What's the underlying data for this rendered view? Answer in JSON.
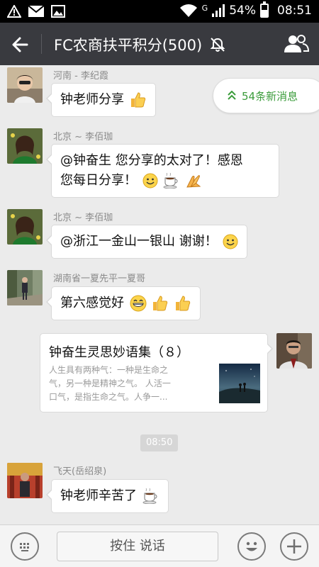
{
  "status_bar": {
    "battery": "54%",
    "battery_level": 0.54,
    "network": "G",
    "time": "08:51",
    "left_icons": [
      "warning-icon",
      "mail-icon",
      "image-icon"
    ]
  },
  "header": {
    "title": "FC农商扶平积分(500)",
    "muted": true
  },
  "new_messages": {
    "label": "54条新消息"
  },
  "messages": [
    {
      "sender": "河南 - 李纪霞",
      "text": "钟老师分享",
      "emojis": [
        "thumbs-up"
      ]
    },
    {
      "sender": "北京 ~ 李佰珈",
      "line1": "@钟奋生 您分享的太对了！感恩",
      "line2": "您每日分享！",
      "emojis": [
        "smile",
        "coffee",
        "pray"
      ]
    },
    {
      "sender": "北京 ~ 李佰珈",
      "text": "@浙江一金山一银山 谢谢！",
      "emojis": [
        "smile"
      ]
    },
    {
      "sender": "湖南省一夏先平一夏哥",
      "text": "第六感觉好",
      "emojis": [
        "grin",
        "thumbs-up",
        "thumbs-up"
      ]
    },
    {
      "sender": "飞天(岳绍泉)",
      "text": "钟老师辛苦了",
      "emojis": [
        "coffee"
      ]
    }
  ],
  "shared_card": {
    "title": "钟奋生灵思妙语集（８）",
    "desc_line1": "人生具有两种气：一种是生命之",
    "desc_line2": "气，另一种是精神之气。   人活一",
    "desc_line3": "口气，是指生命之气。人争一..."
  },
  "time_chip": "08:50",
  "bottom_bar": {
    "hold_to_talk": "按住 说话"
  },
  "colors": {
    "titlebar": "#393a3f",
    "accent_green": "#3b9c3b",
    "chat_bg": "#ebebeb"
  }
}
